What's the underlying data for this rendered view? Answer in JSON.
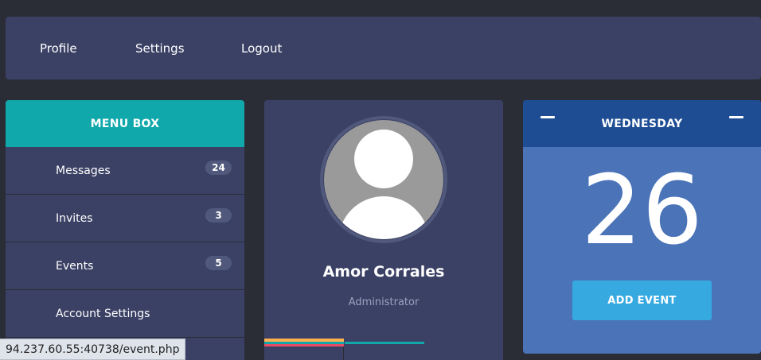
{
  "topbar": {
    "links": [
      {
        "label": "Profile"
      },
      {
        "label": "Settings"
      },
      {
        "label": "Logout"
      }
    ]
  },
  "menu_box": {
    "title": "MENU BOX",
    "items": [
      {
        "label": "Messages",
        "badge": "24"
      },
      {
        "label": "Invites",
        "badge": "3"
      },
      {
        "label": "Events",
        "badge": "5"
      },
      {
        "label": "Account Settings",
        "badge": ""
      }
    ]
  },
  "profile": {
    "name": "Amor Corrales",
    "role": "Administrator",
    "avatar_icon": "user-silhouette-icon"
  },
  "calendar": {
    "weekday": "WEDNESDAY",
    "day": "26",
    "add_event_label": "ADD EVENT"
  },
  "status_bar": {
    "url": "94.237.60.55:40738/event.php"
  },
  "colors": {
    "background": "#2a2d35",
    "panel": "#3b4165",
    "teal": "#11a8ab",
    "calendar_header": "#1e4d94",
    "calendar_body": "#4a73b8",
    "button_blue": "#36a9e1",
    "badge": "#50597b"
  }
}
